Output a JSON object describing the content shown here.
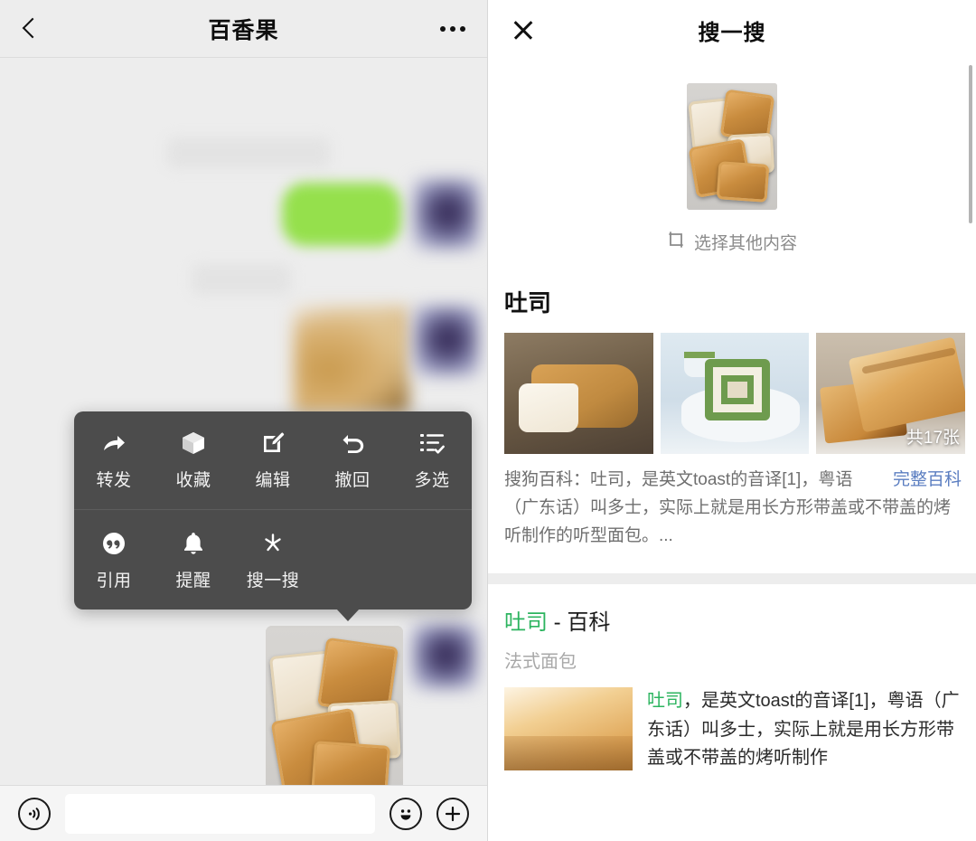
{
  "chat": {
    "header": {
      "title": "百香果",
      "back_icon": "back-chevron-icon",
      "more_icon": "more-options-icon"
    },
    "action_menu": {
      "row1": [
        {
          "label": "转发",
          "icon": "forward-arrow-icon"
        },
        {
          "label": "收藏",
          "icon": "box-favorite-icon"
        },
        {
          "label": "编辑",
          "icon": "edit-pencil-icon"
        },
        {
          "label": "撤回",
          "icon": "undo-recall-icon"
        },
        {
          "label": "多选",
          "icon": "multi-select-list-icon"
        }
      ],
      "row2": [
        {
          "label": "引用",
          "icon": "quote-bubble-icon"
        },
        {
          "label": "提醒",
          "icon": "bell-reminder-icon"
        },
        {
          "label": "搜一搜",
          "icon": "wechat-search-sparkle-icon"
        }
      ]
    },
    "input_bar": {
      "voice_icon": "voice-message-icon",
      "emoji_icon": "emoji-smiley-icon",
      "plus_icon": "plus-more-icon",
      "input_value": "",
      "input_placeholder": ""
    }
  },
  "search": {
    "header": {
      "title": "搜一搜",
      "close_icon": "close-icon"
    },
    "query": {
      "image_alt": "toast-photo",
      "pick_other_label": "选择其他内容",
      "pick_other_icon": "crop-frame-icon"
    },
    "section": {
      "title": "吐司",
      "thumbnails": [
        {
          "alt": "bread-loaf-thumbnail",
          "badge": ""
        },
        {
          "alt": "matcha-swirl-toast-thumbnail",
          "badge": ""
        },
        {
          "alt": "grilled-toast-thumbnail",
          "badge": "共17张"
        }
      ],
      "snippet": "搜狗百科：吐司，是英文toast的音译[1]，粤语（广东话）叫多士，实际上就是用长方形带盖或不带盖的烤听制作的听型面包。...",
      "full_link": "完整百科"
    },
    "result": {
      "title_highlight": "吐司",
      "title_rest": " - 百科",
      "subtitle": "法式面包",
      "thumb_alt": "bread-loaf-result-thumbnail",
      "body_highlight": "吐司",
      "body_rest": "，是英文toast的音译[1]，粤语（广东话）叫多士，实际上就是用长方形带盖或不带盖的烤听制作"
    }
  },
  "colors": {
    "wechat_green": "#2cb45f",
    "bubble_green": "#95e04c",
    "link_blue": "#5b7ec1",
    "menu_dark": "#4c4c4c"
  }
}
